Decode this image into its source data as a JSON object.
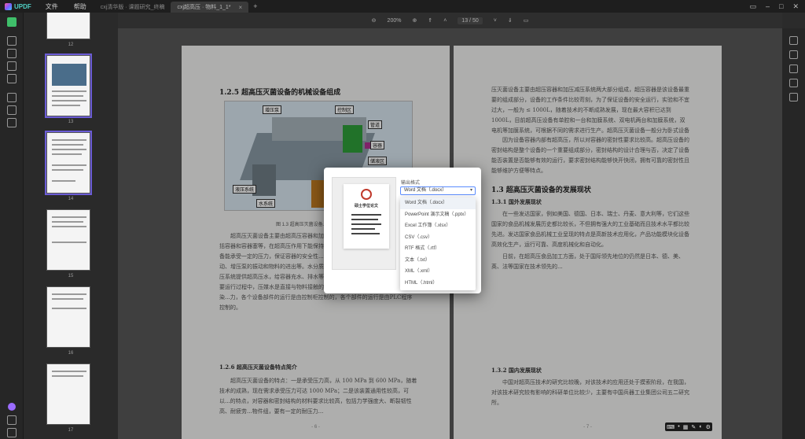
{
  "titlebar": {
    "app_name": "UPDF",
    "menus": [
      "文件",
      "帮助"
    ],
    "tabs": [
      {
        "label": "cxj清华版 · 课题研究_终稿",
        "active": false
      },
      {
        "label": "cxj超高压 · 物料_1_1*",
        "active": true
      }
    ]
  },
  "toolbar": {
    "zoom": "200%",
    "page_current": "13",
    "page_total": "50"
  },
  "thumbnails": [
    {
      "num": "12"
    },
    {
      "num": "13"
    },
    {
      "num": "14"
    },
    {
      "num": "15"
    },
    {
      "num": "16"
    },
    {
      "num": "17"
    }
  ],
  "left_page": {
    "section_title": "1.2.5 超高压灭菌设备的机械设备组成",
    "figure_labels": [
      "增压泵",
      "控制区",
      "管道",
      "容器",
      "储液区",
      "液压系统",
      "水系统"
    ],
    "figure_caption": "图 1.3 超高压灭菌设备...",
    "body1": "超高压灭菌设备主要由超高压容器和加压系统...统是设备处理物料的场所。包括容器和容器塞等，在超高压作用下能保持...种钢的实体结构组成，以此来保证设备能承受一定的压力，保证容器的安全性...设备部件的机械移动和物料的进出等...动、增压泵的振动和物料的进出等。水分质系统主要负责给予传压介质...包括给增压系统提供超高压水，给容器充水、排水等...阀、压力传感器等部件。在设备的主要运行过程中，压媒水是直接与物料接触的，所以水媒介要求干净、无杂质、无污染...力，各个设备部件的运行是由控制柜控制的，各个部件的运行是由PLC程序控制的。",
    "section_title2": "1.2.6 超高压灭菌设备特点简介",
    "body2": "超高压灭菌设备的特点：一是承受压力高，从 100 MPa 到 600 MPa，随着技术的成熟，现在需求承受压力可达 1000 MPa；二是该装置通用性较高，可以...的特点，对容器和密封结构的材料要求比较高，包括力学强度大、断裂韧性高、耐疲劳...物件组，要有一定的耐压力...",
    "page_num": "- 6 -"
  },
  "right_page": {
    "body1": "压灭菌设备主要由超压容器和加压减压系统两大部分组成，超压容器是该设备最重要的组成部分，设备的工作条件比较苛刻，为了保证设备的安全运行，实验和不宜过大，一般为 ≤ 1000L，随着技术的不断成熟发展，现在最大容积已达到 1000L，目前超高压设备有单腔和一台和加膜系统、双电机两台和加膜系统，双电机等加膜系统，可根据不同的需求进行生产。超高压灭菌设备一般分为卧式设备和立式设备。",
    "body2": "因为设备容器内部有超高压，所以对容器的密封性要求比较高。超高压设备的密封结构是整个设备的一个重要组成部分，密封结构的设计合理与否，决定了设备能否装置是否能够有效的运行，要求密封结构能够快开快闭，拥有可靠的密封性且能够维护方便等特点。",
    "section_title": "1.3 超高压灭菌设备的发展现状",
    "sub1": "1.3.1 国外发展现状",
    "body3": "在一些发达国家，例如美国、德国、日本、瑞士、丹麦、意大利等，它们这些国家的食品机械发展历史都比较长，不但拥有强大的工业基础而且技术水平都比较先进。发达国家食品机械工业呈现的特点是高新技术应用化，产品功能模块化设备高效化生产，运行可靠、高度机械化和自动化。",
    "body4": "日前，在超高压食品加工方面，处于国际领先地位的仍然是日本、德、美、英、法等国家在技术领先的...",
    "sub2": "1.3.2 国内发展现状",
    "body5": "中国对超高压技术的研究比较晚，对该技术的应用还处于摸索阶段，在我国，对该技术研究较有影响的科研单位比较少，主要有中国兵器工业集团公司五二研究所。",
    "page_num": "- 7 -"
  },
  "dialog": {
    "preview_title": "硕士学位论文",
    "format_label": "输出格式",
    "selected": "Word 文档（.docx）",
    "options": [
      "Word 文档（.docx）",
      "PowerPoint 演示文稿（.pptx）",
      "Excel 工作簿（.xlsx）",
      "CSV（.csv）",
      "RTF 格式（.rtf）",
      "文本（.txt）",
      "XML（.xml）",
      "HTML（.html）"
    ]
  },
  "colors": {
    "accent": "#6b5cd6",
    "dropdown_border": "#5a8cff",
    "app_green": "#3fbf6a"
  }
}
